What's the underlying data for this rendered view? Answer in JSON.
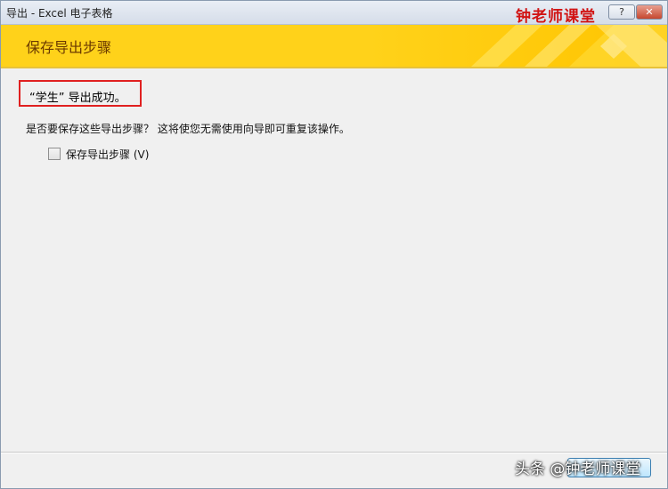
{
  "window": {
    "title": "导出 - Excel 电子表格",
    "help_label": "?",
    "close_label": "✕"
  },
  "watermark_top": "钟老师课堂",
  "banner": {
    "title": "保存导出步骤"
  },
  "main": {
    "success_message": "“学生” 导出成功。",
    "question": "是否要保存这些导出步骤？ 这将使您无需使用向导即可重复该操作。",
    "save_steps_checkbox": {
      "label": "保存导出步骤 (V)",
      "checked": false
    }
  },
  "footer": {
    "watermark": "头条 @钟老师课堂"
  },
  "colors": {
    "banner_yellow": "#ffd21a",
    "highlight_red": "#e02020",
    "watermark_red": "#d11414"
  }
}
